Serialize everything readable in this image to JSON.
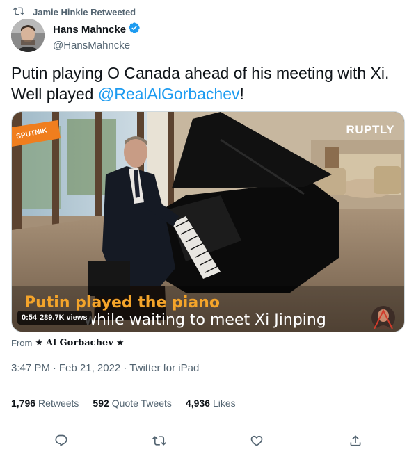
{
  "retweet": {
    "icon": "retweet-icon",
    "text": "Jamie Hinkle Retweeted"
  },
  "author": {
    "name": "Hans Mahncke",
    "handle": "@HansMahncke",
    "verified_icon": "verified-badge-icon"
  },
  "tweet": {
    "line1": "Putin playing O Canada ahead of his meeting with Xi.",
    "line2_prefix": "Well played ",
    "mention": "@RealAlGorbachev",
    "line2_suffix": "!"
  },
  "media": {
    "watermark_left": "SPUTNIK",
    "watermark_right": "RUPTLY",
    "caption_line1": "Putin played the piano",
    "caption_line2": "while waiting to meet Xi Jinping",
    "duration": "0:54",
    "views": "289.7K views"
  },
  "source": {
    "prefix": "From",
    "name": "Al Gorbachev",
    "star_icon": "star-icon"
  },
  "meta": {
    "time": "3:47 PM",
    "separator": "·",
    "date": "Feb 21, 2022",
    "client": "Twitter for iPad"
  },
  "stats": {
    "retweets_count": "1,796",
    "retweets_label": "Retweets",
    "quotes_count": "592",
    "quotes_label": "Quote Tweets",
    "likes_count": "4,936",
    "likes_label": "Likes"
  },
  "actions": [
    "reply-icon",
    "retweet-icon",
    "like-icon",
    "share-icon"
  ],
  "colors": {
    "accent": "#1d9bf0",
    "secondary_text": "#536471",
    "primary_text": "#0f1419",
    "caption_orange": "#f4a42a"
  }
}
